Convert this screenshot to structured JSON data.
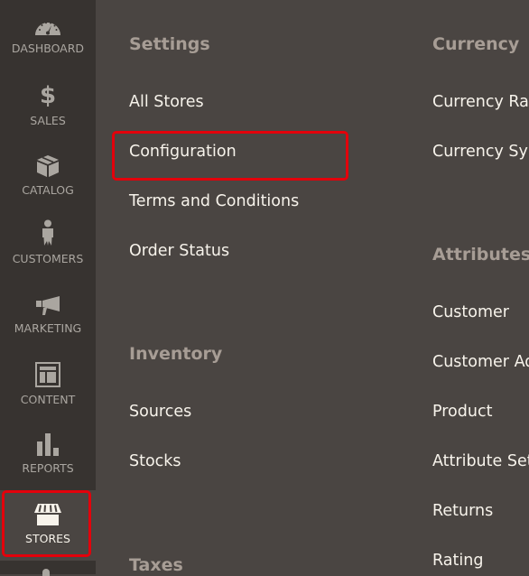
{
  "sidebar": {
    "items": [
      {
        "label": "Dashboard",
        "icon": "dashboard-gauge-icon"
      },
      {
        "label": "Sales",
        "icon": "dollar-icon"
      },
      {
        "label": "Catalog",
        "icon": "box-icon"
      },
      {
        "label": "Customers",
        "icon": "person-icon"
      },
      {
        "label": "Marketing",
        "icon": "megaphone-icon"
      },
      {
        "label": "Content",
        "icon": "layout-icon"
      },
      {
        "label": "Reports",
        "icon": "bar-chart-icon"
      },
      {
        "label": "Stores",
        "icon": "storefront-icon",
        "active": true
      }
    ]
  },
  "menu": {
    "settings": {
      "title": "Settings",
      "links": [
        "All Stores",
        "Configuration",
        "Terms and Conditions",
        "Order Status"
      ]
    },
    "inventory": {
      "title": "Inventory",
      "links": [
        "Sources",
        "Stocks"
      ]
    },
    "taxes": {
      "title": "Taxes"
    },
    "currency": {
      "title": "Currency",
      "links": [
        "Currency Rates",
        "Currency Symbols"
      ]
    },
    "attributes": {
      "title": "Attributes",
      "links": [
        "Customer",
        "Customer Address",
        "Product",
        "Attribute Set",
        "Returns",
        "Rating"
      ]
    }
  },
  "colors": {
    "highlight": "#e3000b",
    "sidebar_bg": "#373330",
    "panel_bg": "#4a4542",
    "section_title": "#a79d95",
    "link": "#f7f3eb"
  }
}
